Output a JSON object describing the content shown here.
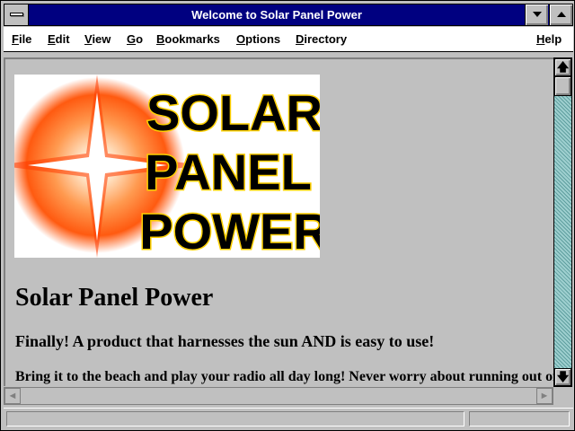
{
  "window": {
    "title": "Welcome to Solar Panel Power"
  },
  "menu": {
    "items": [
      "File",
      "Edit",
      "View",
      "Go",
      "Bookmarks",
      "Options",
      "Directory"
    ],
    "help": "Help"
  },
  "page": {
    "logo": {
      "lines": [
        "SOLAR",
        "PANEL",
        "POWER"
      ],
      "colors": {
        "text_fill": "#000000",
        "text_outline": "#ffd000",
        "glow_outer": "#ff6a00",
        "glow_inner": "#ffb060"
      }
    },
    "heading": "Solar Panel Power",
    "subheading": "Finally! A product that harnesses the sun AND is easy to use!",
    "paragraph": "Bring it to the beach and play your radio all day long! Never worry about running out of"
  },
  "icons": {
    "system_menu": "system-menu-icon",
    "minimize": "minimize-icon",
    "maximize": "maximize-icon",
    "scroll_up": "arrow-up-icon",
    "scroll_down": "arrow-down-icon",
    "scroll_left": "arrow-left-icon",
    "scroll_right": "arrow-right-icon"
  },
  "colors": {
    "titlebar": "#000080",
    "chrome": "#c0c0c0",
    "scroll_track": "#9ecfcf"
  }
}
